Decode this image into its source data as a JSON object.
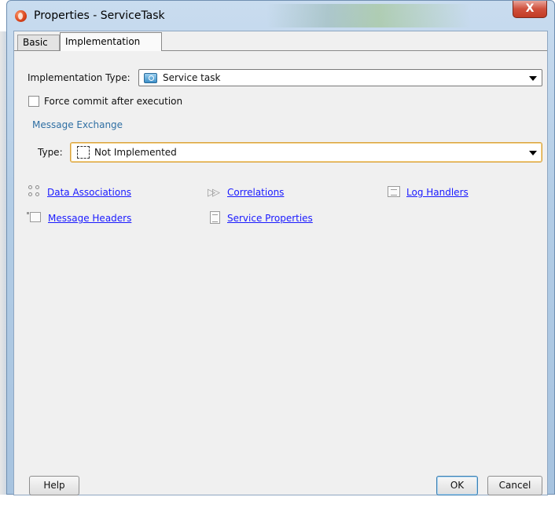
{
  "window": {
    "title": "Properties - ServiceTask",
    "close_label": "X"
  },
  "tabs": [
    {
      "label": "Basic"
    },
    {
      "label": "Implementation"
    }
  ],
  "implementation": {
    "type_label": "Implementation Type:",
    "type_value": "Service task",
    "force_commit_label": "Force commit after execution",
    "force_commit_checked": false,
    "message_exchange_label": "Message Exchange",
    "message_type_label": "Type:",
    "message_type_value": "Not Implemented"
  },
  "links": {
    "data_associations": "Data Associations",
    "correlations": "Correlations",
    "log_handlers": "Log Handlers",
    "message_headers": "Message Headers",
    "service_properties": "Service Properties"
  },
  "buttons": {
    "help": "Help",
    "ok": "OK",
    "cancel": "Cancel"
  },
  "colors": {
    "link": "#1a1aff",
    "section_header": "#2f6fa3",
    "focus_border": "#d9a23d"
  }
}
